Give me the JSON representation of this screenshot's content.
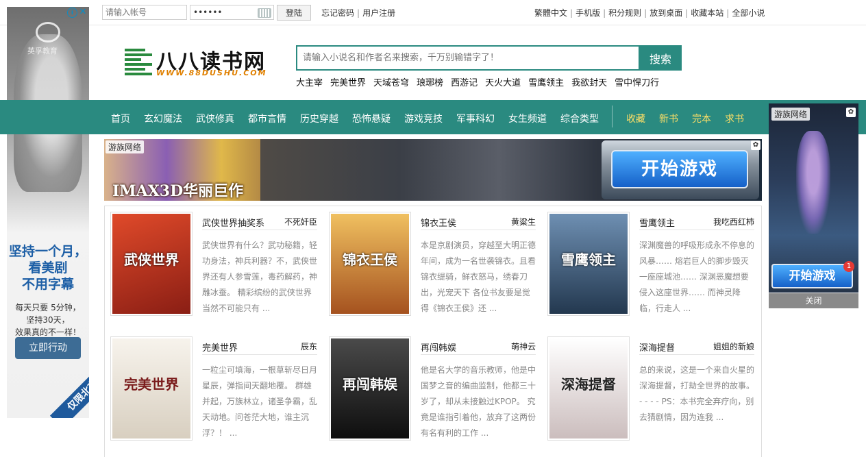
{
  "topbar": {
    "username_placeholder": "请输入帐号",
    "password_value": "••••••",
    "login_label": "登陆",
    "forgot_label": "忘记密码",
    "register_label": "用户注册",
    "right_links": [
      "繁體中文",
      "手机版",
      "积分规则",
      "放到桌面",
      "收藏本站",
      "全部小说"
    ]
  },
  "left_ad": {
    "brand": "英孚教育",
    "headline_1": "坚持一个月，",
    "headline_2": "看美剧",
    "headline_3": "不用字幕",
    "body_1": "每天只要 5分钟，",
    "body_2": "坚持30天，",
    "body_3": "效果真的不一样！",
    "cta": "立即行动",
    "ribbon": "仅限北京"
  },
  "header": {
    "logo_text": "八八读书网",
    "logo_url": "WWW.88DUSHU.COM",
    "search_placeholder": "请输入小说名和作者名来搜索，千万别输错字了！",
    "search_button": "搜索",
    "hot_keywords": [
      "大主宰",
      "完美世界",
      "天域苍穹",
      "琅琊榜",
      "西游记",
      "天火大道",
      "雪鹰领主",
      "我欲封天",
      "雪中悍刀行"
    ]
  },
  "nav": {
    "items": [
      "首页",
      "玄幻魔法",
      "武侠修真",
      "都市言情",
      "历史穿越",
      "恐怖悬疑",
      "游戏竞技",
      "军事科幻",
      "女生频道",
      "综合类型"
    ],
    "extra": [
      "收藏",
      "新书",
      "完本",
      "求书"
    ]
  },
  "banner": {
    "brand": "游族网络",
    "title": "IMAX3D华丽巨作",
    "cta": "开始游戏"
  },
  "books": [
    {
      "title": "武侠世界抽奖系",
      "author": "不死奸臣",
      "cover_text": "武侠世界",
      "cover_color": "#b52a1e",
      "desc": "武侠世界有什么？武功秘籍，轻功身法，神兵利器？不，武侠世界还有人参雪莲，毒药解药，神雕冰蚕。 精彩缤纷的武侠世界当然不可能只有 ..."
    },
    {
      "title": "锦衣王侯",
      "author": "黄粱生",
      "cover_text": "锦衣王侯",
      "cover_color": "#c9832a",
      "desc": "本是京剧演员，穿越至大明正德年间，成为一名世袭锦衣。且看锦衣缇骑，鲜衣怒马，绣春刀出，光宠天下 各位书友要是觉得《锦衣王侯》还 ..."
    },
    {
      "title": "雪鹰领主",
      "author": "我吃西红柿",
      "cover_text": "雪鹰领主",
      "cover_color": "#3d5a7a",
      "desc": "深渊魔兽的呼吸形成永不停息的风暴…… 熔岩巨人的脚步毁灭一座座城池…… 深渊恶魔想要侵入这座世界…… 而神灵降临，行走人 ..."
    },
    {
      "title": "完美世界",
      "author": "辰东",
      "cover_text": "完美世界",
      "cover_color": "#e8e2d8",
      "desc": "一粒尘可填海，一根草斩尽日月星辰，弹指间天翻地覆。 群雄并起，万族林立，诸圣争霸，乱天动地。问苍茫大地，谁主沉浮？！ ..."
    },
    {
      "title": "再闯韩娱",
      "author": "萌神云",
      "cover_text": "再闯韩娱",
      "cover_color": "#2a2a2a",
      "desc": "他是名大学的音乐教师，他是中国梦之音的编曲监制，他都三十岁了，却从未接触过KPOP。 究竟是谁指引着他，放弃了这两份有名有利的工作 ..."
    },
    {
      "title": "深海提督",
      "author": "姐姐的新娘",
      "cover_text": "深海提督",
      "cover_color": "#d9d4d4",
      "desc": "总的来说，这是一个来自火星的深海提督，打劫全世界的故事。 - - - - PS：本书完全弃疗向，别去猜剧情，因为连我 ..."
    }
  ],
  "right_ad": {
    "brand": "游族网络",
    "cta": "开始游戏",
    "badge": "1",
    "close": "关闭"
  }
}
